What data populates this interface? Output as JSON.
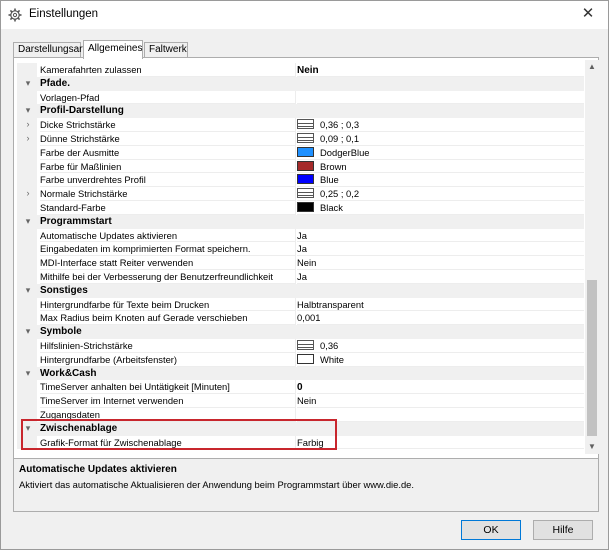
{
  "window": {
    "title": "Einstellungen",
    "close_glyph": "✕",
    "icon": "gear-icon"
  },
  "tabs": [
    {
      "label": "Darstellungsart",
      "active": false
    },
    {
      "label": "Allgemeines",
      "active": true
    },
    {
      "label": "Faltwerk",
      "active": false
    }
  ],
  "rows": [
    {
      "type": "prop",
      "expand": "",
      "name": "Kamerafahrten zulassen",
      "value": "Nein",
      "bold_value": true
    },
    {
      "type": "cat",
      "expand": "▾",
      "name": "Pfade."
    },
    {
      "type": "prop",
      "expand": "",
      "name": "Vorlagen-Pfad",
      "value": ""
    },
    {
      "type": "cat",
      "expand": "▾",
      "name": "Profil-Darstellung"
    },
    {
      "type": "prop",
      "expand": "›",
      "name": "Dicke Strichstärke",
      "value": "0,36 ; 0,3",
      "icon": "line"
    },
    {
      "type": "prop",
      "expand": "›",
      "name": "Dünne Strichstärke",
      "value": "0,09 ; 0,1",
      "icon": "line"
    },
    {
      "type": "prop",
      "expand": "",
      "name": "Farbe der Ausmitte",
      "value": "DodgerBlue",
      "swatch": "#1e90ff"
    },
    {
      "type": "prop",
      "expand": "",
      "name": "Farbe für Maßlinien",
      "value": "Brown",
      "swatch": "#a52a2a"
    },
    {
      "type": "prop",
      "expand": "",
      "name": "Farbe unverdrehtes Profil",
      "value": "Blue",
      "swatch": "#0000ff"
    },
    {
      "type": "prop",
      "expand": "›",
      "name": "Normale Strichstärke",
      "value": "0,25 ; 0,2",
      "icon": "line"
    },
    {
      "type": "prop",
      "expand": "",
      "name": "Standard-Farbe",
      "value": "Black",
      "swatch": "#000000"
    },
    {
      "type": "cat",
      "expand": "▾",
      "name": "Programmstart"
    },
    {
      "type": "prop",
      "expand": "",
      "name": "Automatische Updates aktivieren",
      "value": "Ja"
    },
    {
      "type": "prop",
      "expand": "",
      "name": "Eingabedaten im komprimierten Format speichern.",
      "value": "Ja"
    },
    {
      "type": "prop",
      "expand": "",
      "name": "MDI-Interface statt Reiter verwenden",
      "value": "Nein"
    },
    {
      "type": "prop",
      "expand": "",
      "name": "Mithilfe bei der Verbesserung der Benutzerfreundlichkeit",
      "value": "Ja"
    },
    {
      "type": "cat",
      "expand": "▾",
      "name": "Sonstiges"
    },
    {
      "type": "prop",
      "expand": "",
      "name": "Hintergrundfarbe für Texte beim Drucken",
      "value": "Halbtransparent"
    },
    {
      "type": "prop",
      "expand": "",
      "name": "Max Radius beim Knoten auf Gerade verschieben",
      "value": "0,001"
    },
    {
      "type": "cat",
      "expand": "▾",
      "name": "Symbole"
    },
    {
      "type": "prop",
      "expand": "",
      "name": "Hilfslinien-Strichstärke",
      "value": "0,36",
      "icon": "line"
    },
    {
      "type": "prop",
      "expand": "",
      "name": "Hintergrundfarbe (Arbeitsfenster)",
      "value": "White",
      "swatch": "#ffffff"
    },
    {
      "type": "cat",
      "expand": "▾",
      "name": "Work&Cash"
    },
    {
      "type": "prop",
      "expand": "",
      "name": "TimeServer anhalten bei Untätigkeit [Minuten]",
      "value": "0",
      "bold_value": true
    },
    {
      "type": "prop",
      "expand": "",
      "name": "TimeServer im Internet verwenden",
      "value": "Nein"
    },
    {
      "type": "prop",
      "expand": "",
      "name": "Zugangsdaten",
      "value": ""
    },
    {
      "type": "cat",
      "expand": "▾",
      "name": "Zwischenablage"
    },
    {
      "type": "prop",
      "expand": "",
      "name": "Grafik-Format für Zwischenablage",
      "value": "Farbig"
    }
  ],
  "scrollbar": {
    "up_glyph": "▲",
    "down_glyph": "▼"
  },
  "help": {
    "title": "Automatische Updates aktivieren",
    "text": "Aktiviert das automatische Aktualisieren der Anwendung beim Programmstart über www.die.de."
  },
  "buttons": {
    "ok": "OK",
    "help": "Hilfe"
  }
}
